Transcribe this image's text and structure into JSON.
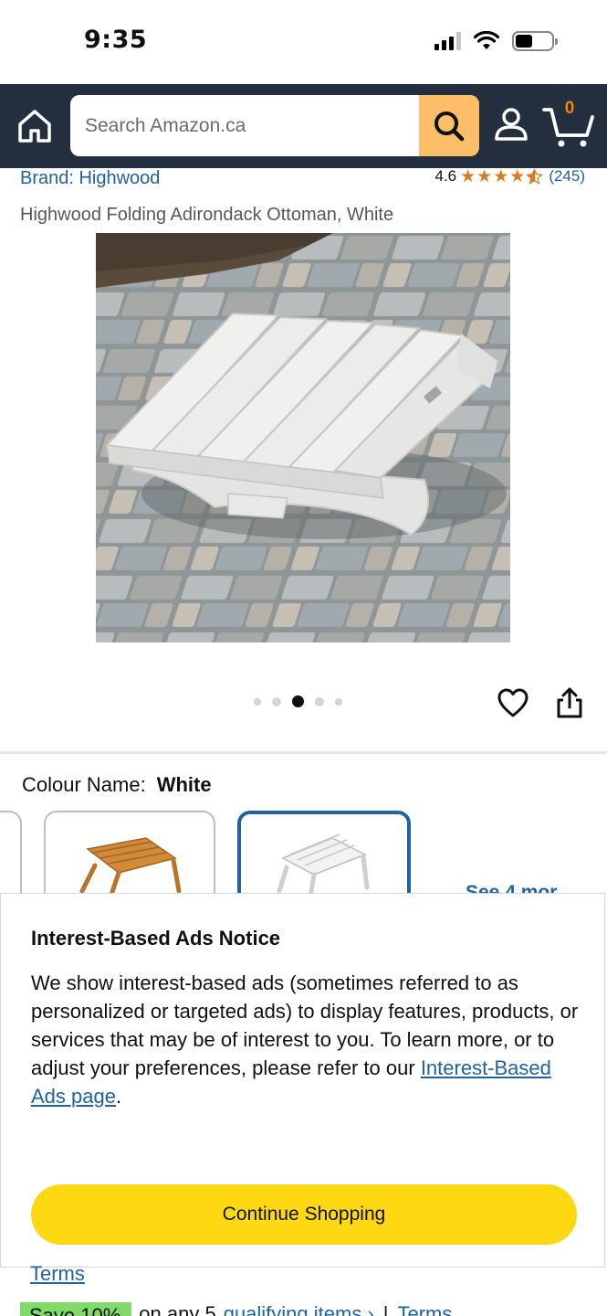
{
  "status_bar": {
    "time": "9:35"
  },
  "header": {
    "search_placeholder": "Search Amazon.ca",
    "cart_count": "0"
  },
  "product": {
    "brand": "Brand: Highwood",
    "rating_value": "4.6",
    "rating_stars": 4.6,
    "rating_count": "(245)",
    "title": "Highwood Folding Adirondack Ottoman, White",
    "image_count": 5,
    "active_image_index": 2
  },
  "colour": {
    "label": "Colour Name:",
    "value": "White",
    "see_more": "See 4 mor"
  },
  "modal": {
    "title": "Interest-Based Ads Notice",
    "body": "We show interest-based ads (sometimes referred to as personalized or targeted ads) to display features, products, or services that may be of interest to you. To learn more, or to adjust your preferences, please refer to our",
    "link_text": "Interest-Based Ads page",
    "body_end": ".",
    "button_label": "Continue Shopping"
  },
  "below_modal": {
    "terms": "Terms",
    "save_badge": "Save 10%",
    "offer_text": "on any 5",
    "qualifying_link": "qualifying items ›",
    "separator": "|",
    "terms2": "Terms"
  },
  "colors": {
    "header_bg": "#232f3e",
    "search_button": "#febd69",
    "link": "#2162a1",
    "star": "#de7921",
    "primary_button": "#ffd814",
    "save_badge": "#7fda69"
  }
}
